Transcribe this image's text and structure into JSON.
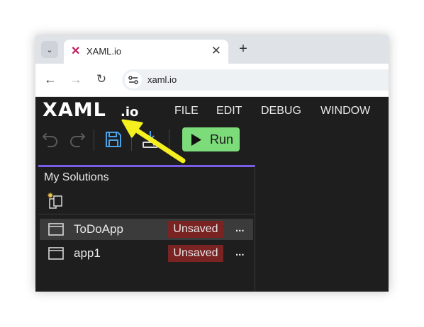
{
  "browser": {
    "tab_title": "XAML.io",
    "tab_close": "✕",
    "new_tab": "+",
    "url": "xaml.io"
  },
  "app": {
    "logo": "XAML",
    "logo_suffix": ".io",
    "menu": [
      "FILE",
      "EDIT",
      "DEBUG",
      "WINDOW"
    ],
    "toolbar": {
      "run_label": "Run",
      "save_icon_color": "#4aa3e8",
      "run_color": "#7ddc7a"
    },
    "solutions_panel": {
      "title": "My Solutions",
      "accent_color": "#7a5ce6",
      "items": [
        {
          "name": "ToDoApp",
          "status": "Unsaved",
          "more": "...",
          "selected": true
        },
        {
          "name": "app1",
          "status": "Unsaved",
          "more": "...",
          "selected": false
        }
      ]
    }
  },
  "annotation": {
    "arrow_color": "#f5f01e",
    "points_to": "save-icon"
  }
}
